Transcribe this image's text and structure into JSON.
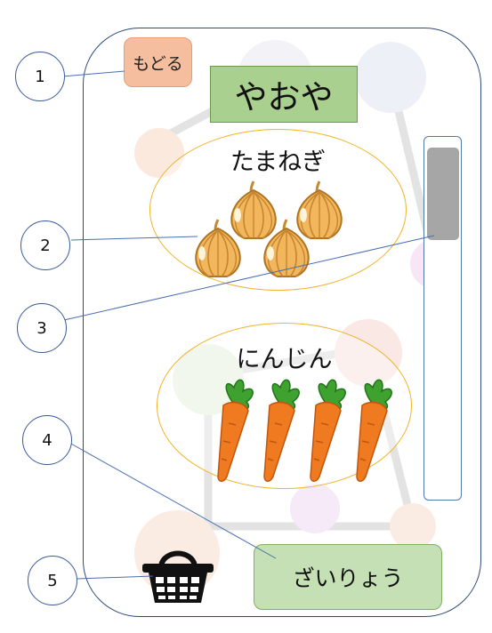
{
  "app": {
    "back_label": "もどる",
    "title": "やおや",
    "ingredients_label": "ざいりょう"
  },
  "items": [
    {
      "name": "たまねぎ",
      "icon": "onion-icon",
      "count": 4
    },
    {
      "name": "にんじん",
      "icon": "carrot-icon",
      "count": 4
    }
  ],
  "scrollbar": {
    "position": 0.0
  },
  "basket_icon": "shopping-basket-icon",
  "callouts": [
    "1",
    "2",
    "3",
    "4",
    "5"
  ],
  "colors": {
    "back_button": "#f5bf9f",
    "title_bg": "#a9d08e",
    "ingredients_button": "#c5e0b4",
    "item_border": "#f0b42b",
    "scroll_thumb": "#a6a6a6"
  }
}
